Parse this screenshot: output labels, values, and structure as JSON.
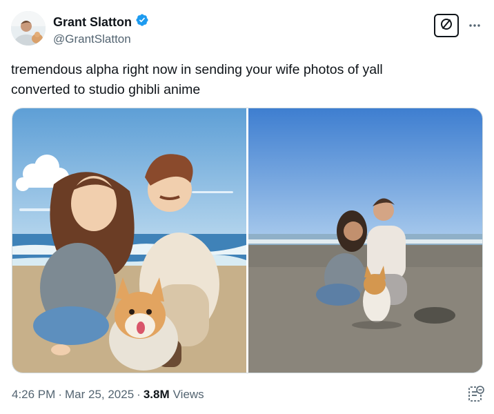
{
  "author": {
    "display_name": "Grant Slatton",
    "handle": "@GrantSlatton",
    "verified": true,
    "verified_color": "#1d9bf0"
  },
  "actions": {
    "grok_icon": "grok-slash-circle-icon",
    "more_icon": "more-horizontal-icon"
  },
  "tweet": {
    "text": "tremendous alpha right now in sending your wife photos of yall\nconverted to studio ghibli anime"
  },
  "media": [
    {
      "kind": "photo",
      "style": "anime illustration"
    },
    {
      "kind": "photo",
      "style": "beach photograph"
    }
  ],
  "meta": {
    "time": "4:26 PM",
    "separator": "·",
    "date": "Mar 25, 2025",
    "views_count": "3.8M",
    "views_label": "Views"
  },
  "colors": {
    "text_primary": "#0f1419",
    "text_secondary": "#536471",
    "border": "#cfd9de"
  }
}
